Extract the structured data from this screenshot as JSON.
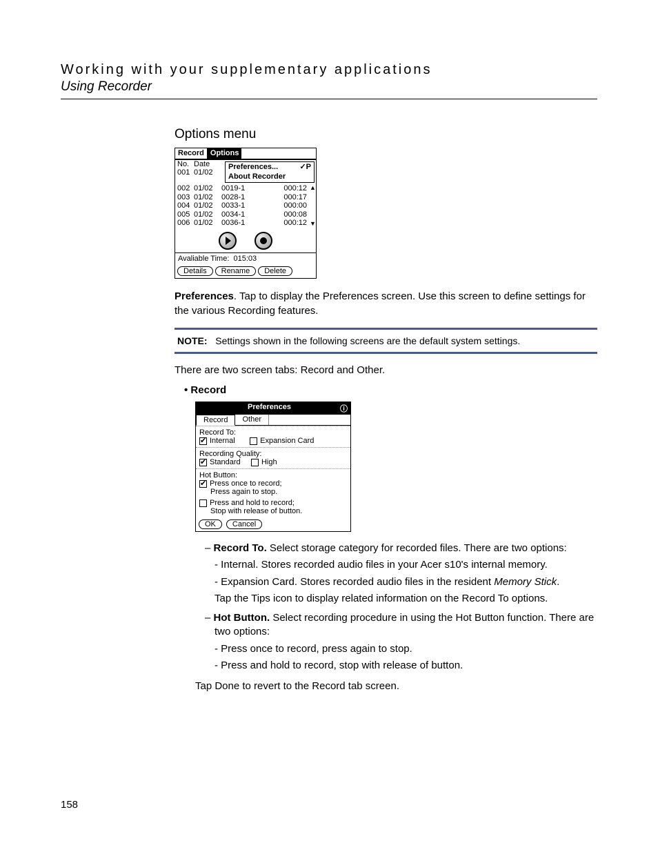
{
  "header": {
    "title": "Working with your supplementary applications",
    "subtitle": "Using Recorder"
  },
  "section_heading": "Options menu",
  "options_screen": {
    "tabs": {
      "left": "Record",
      "right": "Options"
    },
    "menu": {
      "preferences": "Preferences...",
      "pref_shortcut": "✓P",
      "about": "About Recorder"
    },
    "columns": {
      "no": "No.",
      "date": "Date"
    },
    "rows": [
      {
        "no": "001",
        "date": "01/02",
        "name": "",
        "dur": ""
      },
      {
        "no": "002",
        "date": "01/02",
        "name": "0019-1",
        "dur": "000:12"
      },
      {
        "no": "003",
        "date": "01/02",
        "name": "0028-1",
        "dur": "000:17"
      },
      {
        "no": "004",
        "date": "01/02",
        "name": "0033-1",
        "dur": "000:00"
      },
      {
        "no": "005",
        "date": "01/02",
        "name": "0034-1",
        "dur": "000:08"
      },
      {
        "no": "006",
        "date": "01/02",
        "name": "0036-1",
        "dur": "000:12"
      }
    ],
    "available_label": "Avaliable Time:",
    "available_value": "015:03",
    "buttons": {
      "details": "Details",
      "rename": "Rename",
      "delete": "Delete"
    }
  },
  "paragraphs": {
    "preferences_lead": "Preferences",
    "preferences_rest": ". Tap to display the Preferences screen. Use this screen to define settings for the various Recording features.",
    "note_lead": "NOTE:",
    "note_rest": "Settings shown in the following screens are the default system settings.",
    "tabs_sentence": "There are two screen tabs: Record and Other.",
    "record_bullet": "Record"
  },
  "pref_screen": {
    "title": "Preferences",
    "info_icon": "ⓘ",
    "tabs": {
      "record": "Record",
      "other": "Other"
    },
    "record_to_label": "Record To:",
    "internal": "Internal",
    "expansion": "Expansion Card",
    "quality_label": "Recording Quality:",
    "standard": "Standard",
    "high": "High",
    "hot_label": "Hot Button:",
    "hot_opt1a": "Press once to record;",
    "hot_opt1b": "Press again to stop.",
    "hot_opt2a": "Press and hold to record;",
    "hot_opt2b": "Stop with release of button.",
    "ok": "OK",
    "cancel": "Cancel"
  },
  "desc": {
    "record_to_head": "Record To.",
    "record_to_body": " Select storage category for recorded files. There are two options:",
    "internal_line": "- Internal. Stores recorded audio files in your Acer s10's internal memory.",
    "expansion_line_a": "- Expansion Card. Stores recorded audio files in the resident ",
    "expansion_line_b": "Memory Stick",
    "expansion_line_c": ".",
    "tips_line": "Tap the Tips icon to display related information on the Record To options.",
    "hot_head": "Hot Button.",
    "hot_body": " Select recording procedure in using the Hot Button function. There are two options:",
    "hot_opt1": "- Press once to record, press again to stop.",
    "hot_opt2": "- Press and hold to record, stop with release of button.",
    "done_line": "Tap Done to revert to the Record tab screen."
  },
  "page_number": "158"
}
